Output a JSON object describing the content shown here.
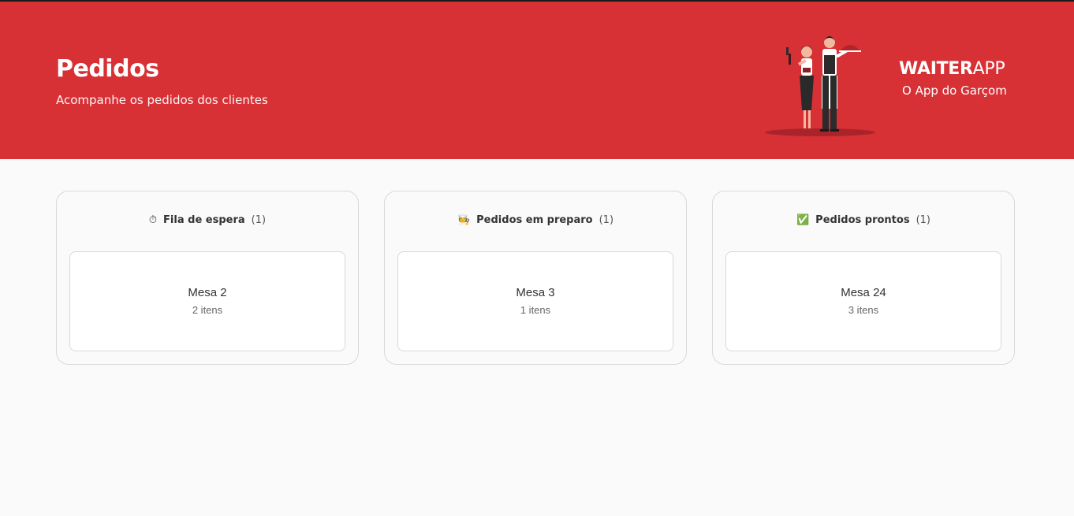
{
  "header": {
    "title": "Pedidos",
    "subtitle": "Acompanhe os pedidos dos clientes",
    "brand_bold": "WAITER",
    "brand_light": "APP",
    "tagline": "O App do Garçom",
    "illustration": "waiters-illustration"
  },
  "colors": {
    "accent": "#D73035",
    "background": "#FAFAFA",
    "border": "#D9D9DC"
  },
  "columns": [
    {
      "icon": "⏱",
      "icon_name": "stopwatch-icon",
      "title": "Fila de espera",
      "count": "(1)",
      "orders": [
        {
          "table": "Mesa 2",
          "items": "2 itens"
        }
      ]
    },
    {
      "icon": "🧑‍🍳",
      "icon_name": "cook-icon",
      "title": "Pedidos em preparo",
      "count": "(1)",
      "orders": [
        {
          "table": "Mesa 3",
          "items": "1 itens"
        }
      ]
    },
    {
      "icon": "✅",
      "icon_name": "check-mark-icon",
      "title": "Pedidos prontos",
      "count": "(1)",
      "orders": [
        {
          "table": "Mesa 24",
          "items": "3 itens"
        }
      ]
    }
  ]
}
